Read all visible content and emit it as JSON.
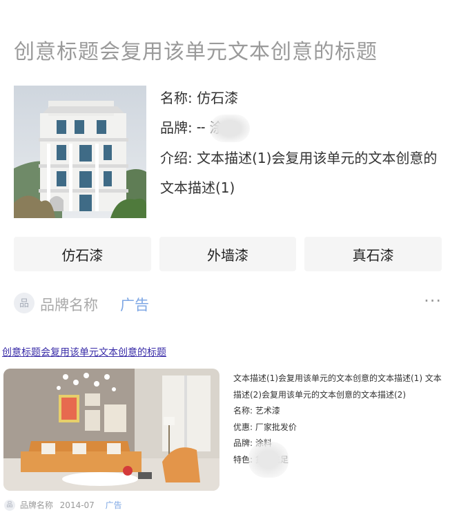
{
  "ad1": {
    "title": "创意标题会复用该单元文本创意的标题",
    "name_row": "名称: 仿石漆",
    "brand_row": "品牌: ╌ 涂料",
    "intro_row": "介绍: 文本描述(1)会复用该单元的文本创意的文本描述(1)",
    "buttons": [
      "仿石漆",
      "外墙漆",
      "真石漆"
    ],
    "avatar": "品",
    "brand_name": "品牌名称",
    "ad_tag": "广告",
    "more": "···"
  },
  "ad2": {
    "title": "创意标题会复用该单元文本创意的标题",
    "description": "文本描述(1)会复用该单元的文本创意的文本描述(1) 文本描述(2)会复用该单元的文本创意的文本描述(2)",
    "name_row": "名称: 艺术漆",
    "offer_row": "优惠: 厂家批发价",
    "brand_row": "品牌: 涂料",
    "feature_row": "特色: 货源充足",
    "avatar": "品",
    "brand_name": "品牌名称",
    "date": "2014-07",
    "ad_tag": "广告"
  },
  "colors": {
    "title_gray": "#9a9a9a",
    "ad_tag_blue": "#7ea7e4",
    "link_purple": "#3a2da8",
    "button_bg": "#f5f5f5"
  }
}
